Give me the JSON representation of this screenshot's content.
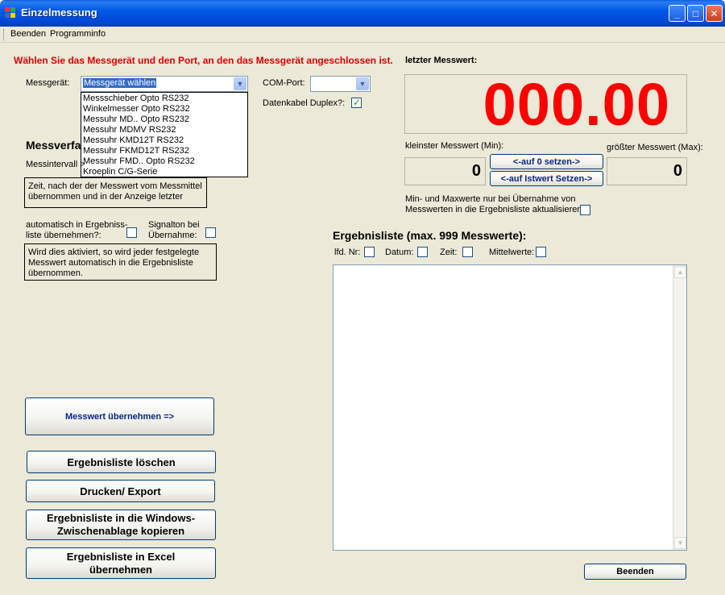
{
  "window": {
    "title": "Einzelmessung",
    "minimize": "_",
    "maximize": "□",
    "close": "✕"
  },
  "menu": {
    "beenden": "Beenden",
    "programminfo": "Programminfo"
  },
  "header": {
    "instruction": "Wählen Sie das Messgerät und den Port, an den das Messgerät angeschlossen ist."
  },
  "device": {
    "label": "Messgerät:",
    "selected": "Messgerät wählen",
    "options": [
      "Messschieber Opto RS232",
      "Winkelmesser Opto RS232",
      "Messuhr MD.. Opto RS232",
      "Messuhr MDMV RS232",
      "Messuhr KMD12T RS232",
      "Messuhr FKMD12T RS232",
      "Messuhr FMD.. Opto RS232",
      "Kroeplin C/G-Serie"
    ]
  },
  "port": {
    "label": "COM-Port:",
    "duplex_label": "Datenkabel Duplex?:",
    "duplex_checked": true
  },
  "method": {
    "heading": "Messverfa",
    "interval_label": "Messintervall >",
    "interval_help": "Zeit, nach der der Messwert vom Messmittel übernommen und in der Anzeige letzter",
    "auto_label": "automatisch in Ergebniss-liste übernehmen?:",
    "signal_label": "Signalton bei Übernahme:",
    "auto_help": "Wird dies aktiviert, so wird jeder festgelegte Messwert automatisch in die Ergebnisliste übernommen."
  },
  "measurement": {
    "last_label": "letzter Messwert:",
    "last_value": "000.00",
    "min_label": "kleinster Messwert (Min):",
    "max_label": "größter Messwert (Max):",
    "min_value": "0",
    "max_value": "0",
    "reset_zero": "<-auf 0 setzen->",
    "set_actual": "<-auf Istwert Setzen->",
    "minmax_note": "Min- und Maxwerte nur bei Übernahme von Messwerten in die Ergebnisliste aktualisieren:"
  },
  "results": {
    "heading": "Ergebnisliste (max. 999 Messwerte):",
    "col_lfd": "lfd. Nr:",
    "col_datum": "Datum:",
    "col_zeit": "Zeit:",
    "col_mittel": "Mittelwerte:"
  },
  "buttons": {
    "take": "Messwert übernehmen =>",
    "clear": "Ergebnisliste löschen",
    "print": "Drucken/ Export",
    "clipboard": "Ergebnisliste in die Windows-Zwischenablage kopieren",
    "excel": "Ergebnisliste in Excel übernehmen",
    "close": "Beenden"
  },
  "colors": {
    "accent_red": "#ff0000",
    "heading_red": "#e00000",
    "titlebar_blue": "#0058e6"
  }
}
